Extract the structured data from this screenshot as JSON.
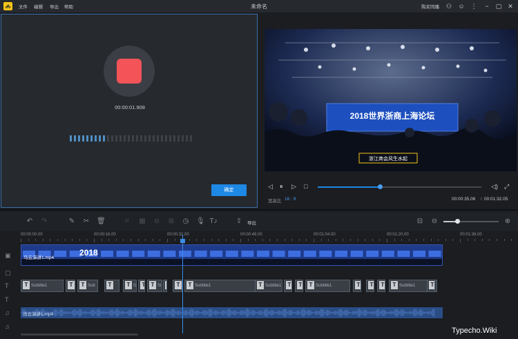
{
  "app": {
    "title": "未命名",
    "menu": [
      "文件",
      "编辑",
      "导出",
      "帮助"
    ],
    "purchase_label": "购买同播"
  },
  "recorder": {
    "elapsed": "00:00:01.908",
    "confirm_label": "确定",
    "level_active": 0.3
  },
  "preview": {
    "banner_text": "2018世界浙商上海论坛",
    "caption": "浙江商会风生水起",
    "aspect_label": "宽高比",
    "aspect_value": "16 : 9",
    "current_time": "00:00:35.06",
    "duration": "00:01:32.05",
    "progress": 0.38
  },
  "toolbar": {
    "export_label": "导出",
    "zoom_level": 0.25
  },
  "timeline": {
    "ruler": [
      "00:00:00.00",
      "00:00:16.00",
      "00:00:32.00",
      "00:00:48.00",
      "00:01:04.00",
      "00:01:20.00",
      "00:01:36.00"
    ],
    "video_clip": "马云演讲1.mp4",
    "audio_clip": "马云演讲1.mp4",
    "subtitles": [
      "Subtitle1",
      "Sub",
      "Su",
      "Si",
      "Subtitle1",
      "Subtitle1",
      "Subtitle1",
      "Subtitle1"
    ]
  },
  "watermark": "Typecho.Wiki",
  "colors": {
    "accent": "#1e88e5",
    "record": "#f45458",
    "logo": "#f5c518",
    "selection_border": "#3a6fa8"
  }
}
